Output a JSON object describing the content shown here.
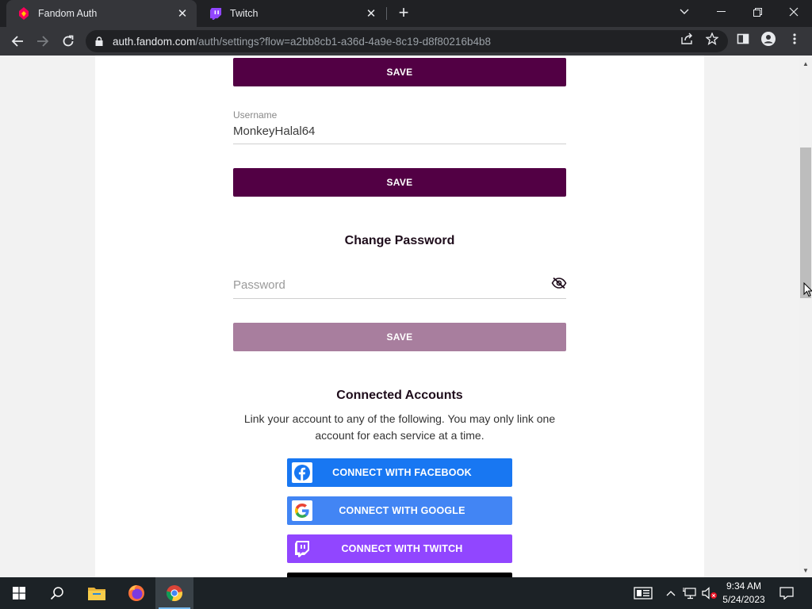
{
  "browser": {
    "tabs": [
      {
        "title": "Fandom Auth",
        "active": true
      },
      {
        "title": "Twitch",
        "active": false
      }
    ],
    "url_host": "auth.fandom.com",
    "url_path": "/auth/settings?flow=a2bb8cb1-a36d-4a9e-8c19-d8f80216b4b8"
  },
  "page": {
    "save_label_top": "SAVE",
    "username_label": "Username",
    "username_value": "MonkeyHalal64",
    "save_label_username": "SAVE",
    "change_password_title": "Change Password",
    "password_placeholder": "Password",
    "save_label_password": "SAVE",
    "connected_title": "Connected Accounts",
    "connected_desc": "Link your account to any of the following. You may only link one account for each service at a time.",
    "connect_facebook": "CONNECT WITH FACEBOOK",
    "connect_google": "CONNECT WITH GOOGLE",
    "connect_twitch": "CONNECT WITH TWITCH"
  },
  "colors": {
    "save_active": "#520044",
    "save_disabled": "#a87e9e",
    "facebook": "#1877f2",
    "google": "#4285f4",
    "twitch": "#9146ff"
  },
  "taskbar": {
    "time": "9:34 AM",
    "date": "5/24/2023"
  }
}
